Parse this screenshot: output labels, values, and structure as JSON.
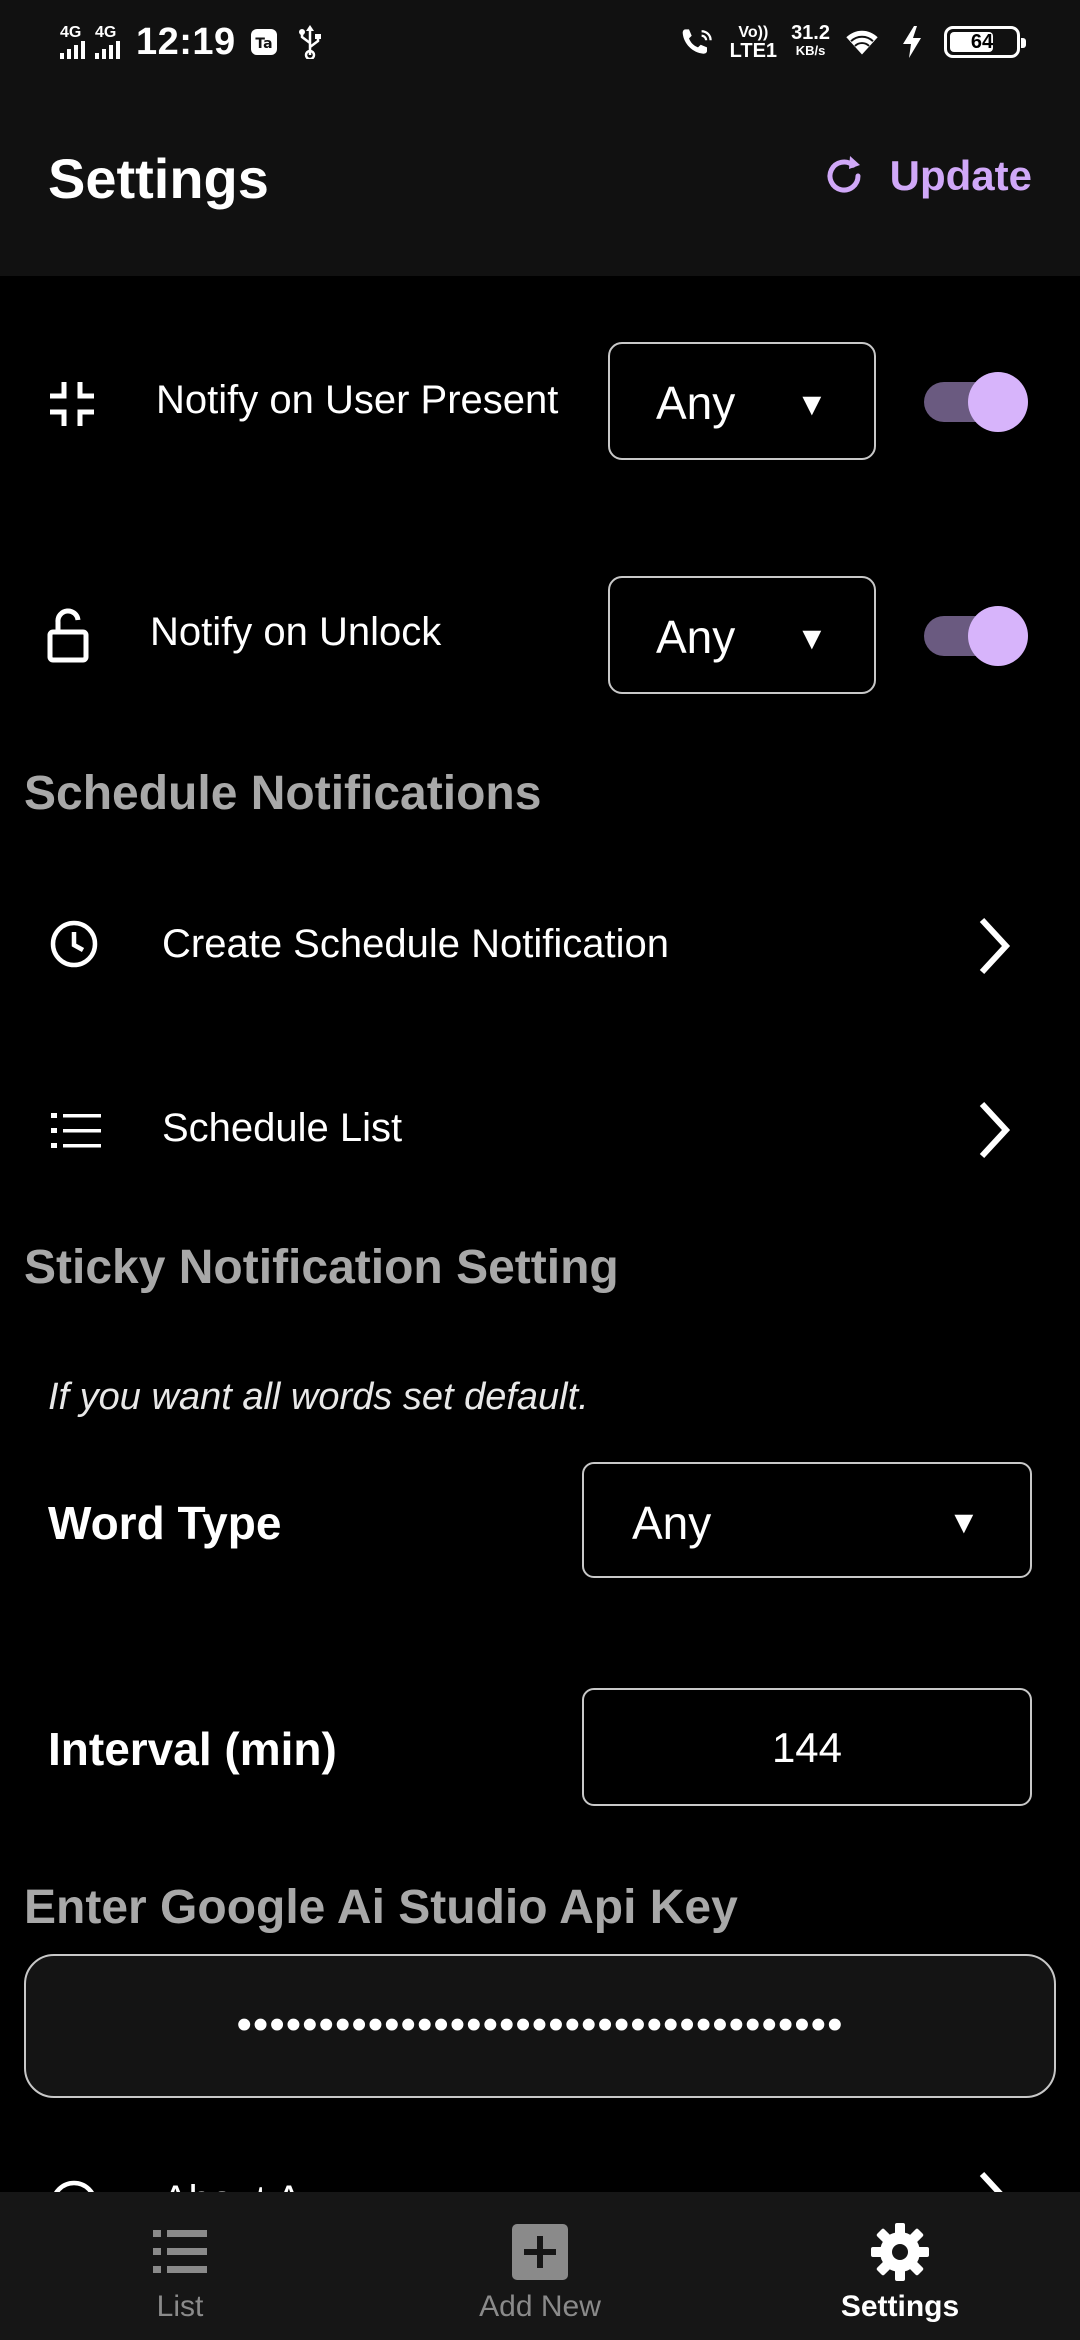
{
  "status_bar": {
    "time": "12:19",
    "signal1_label": "4G",
    "signal2_label": "4G",
    "volte_top": "Vo))",
    "volte_bottom": "LTE1",
    "net_speed_value": "31.2",
    "net_speed_unit": "KB/s",
    "battery_level": "64"
  },
  "app_bar": {
    "title": "Settings",
    "update_label": "Update",
    "accent_color": "#d0a8f8"
  },
  "notify_user_present": {
    "label": "Notify on User Present",
    "dropdown_value": "Any",
    "dropdown_arrow": "▼",
    "enabled": true
  },
  "notify_unlock": {
    "label": "Notify on Unlock",
    "dropdown_value": "Any",
    "dropdown_arrow": "▼",
    "enabled": true
  },
  "schedule_section": {
    "title": "Schedule Notifications",
    "items": [
      {
        "label": "Create Schedule Notification",
        "icon": "clock-icon"
      },
      {
        "label": "Schedule List",
        "icon": "list-icon"
      }
    ]
  },
  "sticky_section": {
    "title": "Sticky Notification Setting",
    "hint": "If you want all words set default.",
    "word_type_label": "Word Type",
    "word_type_value": "Any",
    "word_type_arrow": "▼",
    "interval_label": "Interval (min)",
    "interval_value": "144"
  },
  "api_section": {
    "title": "Enter Google Ai Studio Api Key",
    "masked_value": "•••••••••••••••••••••••••••••••••••••"
  },
  "partial_row": {
    "label": "About A"
  },
  "bottom_nav": {
    "items": [
      {
        "label": "List",
        "icon": "list-icon",
        "active": false
      },
      {
        "label": "Add New",
        "icon": "add-box-icon",
        "active": false
      },
      {
        "label": "Settings",
        "icon": "gear-icon",
        "active": true
      }
    ]
  }
}
